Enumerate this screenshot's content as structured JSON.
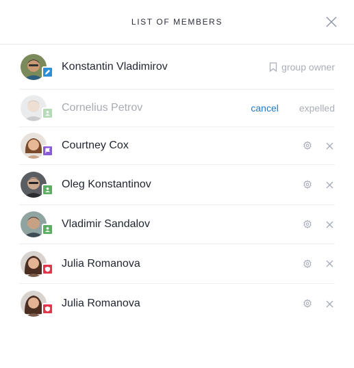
{
  "dialog": {
    "title": "LIST OF MEMBERS",
    "close_icon": "close-icon"
  },
  "colors": {
    "accent_link": "#1f78c9",
    "muted_text": "#a9aeb8",
    "badge_blue": "#2f8fd6",
    "badge_green": "#5cae63",
    "badge_purple": "#8a5bd8",
    "badge_red": "#e2344b"
  },
  "members": [
    {
      "name": "Konstantin Vladimirov",
      "badge": "pencil-icon",
      "badge_color": "#2f8fd6",
      "role_label": "group owner",
      "role_icon": "bookmark-icon"
    },
    {
      "name": "Cornelius Petrov",
      "badge": "user-icon",
      "badge_color": "#5cae63",
      "action_label": "cancel",
      "status_label": "expelled"
    },
    {
      "name": "Courtney Cox",
      "badge": "flag-icon",
      "badge_color": "#8a5bd8",
      "actions": [
        "gear-icon",
        "close-icon"
      ]
    },
    {
      "name": "Oleg Konstantinov",
      "badge": "user-icon",
      "badge_color": "#5cae63",
      "actions": [
        "gear-icon",
        "close-icon"
      ]
    },
    {
      "name": "Vladimir Sandalov",
      "badge": "user-icon",
      "badge_color": "#5cae63",
      "actions": [
        "gear-icon",
        "close-icon"
      ]
    },
    {
      "name": "Julia Romanova",
      "badge": "shield-icon",
      "badge_color": "#e2344b",
      "actions": [
        "gear-icon",
        "close-icon"
      ]
    },
    {
      "name": "Julia Romanova",
      "badge": "shield-icon",
      "badge_color": "#e2344b",
      "actions": [
        "gear-icon",
        "close-icon"
      ]
    }
  ]
}
